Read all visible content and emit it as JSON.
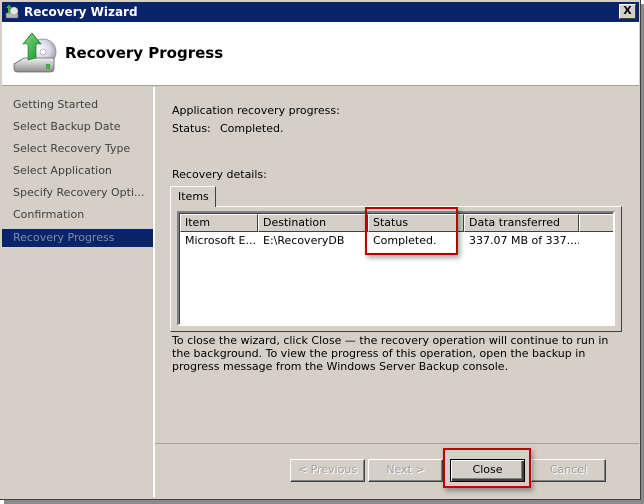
{
  "window": {
    "title": "Recovery Wizard",
    "close_label": "X"
  },
  "header": {
    "title": "Recovery Progress",
    "icon": "backup-restore-disk-icon"
  },
  "sidebar": {
    "items": [
      {
        "label": "Getting Started",
        "active": false
      },
      {
        "label": "Select Backup Date",
        "active": false
      },
      {
        "label": "Select Recovery Type",
        "active": false
      },
      {
        "label": "Select Application",
        "active": false
      },
      {
        "label": "Specify Recovery Opti...",
        "active": false
      },
      {
        "label": "Confirmation",
        "active": false
      },
      {
        "label": "Recovery Progress",
        "active": true
      }
    ]
  },
  "main": {
    "progress_label": "Application recovery progress:",
    "status_label": "Status:",
    "status_value": "Completed.",
    "details_label": "Recovery details:",
    "tabs": [
      {
        "label": "Items"
      }
    ],
    "table": {
      "columns": [
        "Item",
        "Destination",
        "Status",
        "Data transferred",
        ""
      ],
      "rows": [
        {
          "item": "Microsoft E...",
          "destination": "E:\\RecoveryDB",
          "status": "Completed.",
          "data_transferred": "337.07 MB of 337...."
        }
      ]
    },
    "info_text": "To close the wizard, click Close — the recovery operation will continue to run in the background. To view the progress of this operation, open the backup in progress message from the Windows Server Backup console."
  },
  "buttons": {
    "previous": "< Previous",
    "next": "Next >",
    "close": "Close",
    "cancel": "Cancel"
  },
  "annotations": {
    "highlight_color": "#c00000"
  }
}
